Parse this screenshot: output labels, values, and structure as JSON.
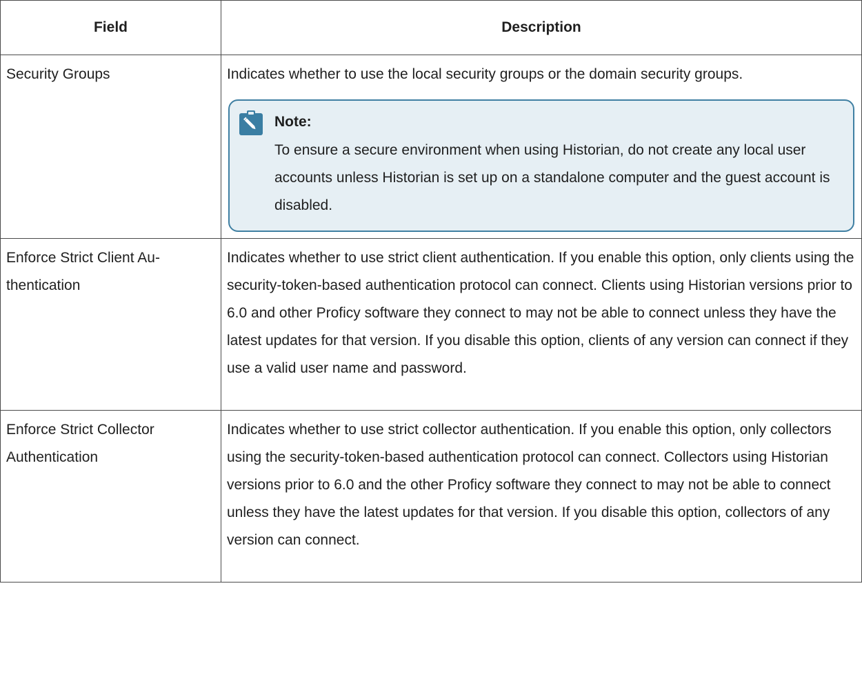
{
  "table": {
    "headers": {
      "field": "Field",
      "description": "Description"
    },
    "rows": [
      {
        "field": "Security Groups",
        "description": "Indicates whether to use the local security groups or the domain security groups.",
        "note": {
          "icon": "pencil-note-icon",
          "heading": "Note:",
          "body": "To ensure a secure environment when using Historian, do not create any local user accounts unless Historian is set up on a standalone computer and the guest account is disabled."
        }
      },
      {
        "field": "Enforce Strict Client Au­thentication",
        "description": "Indicates whether to use strict client authentication. If you enable this option, only clients using the security-token-based authentication protocol can con­nect. Clients using Historian versions prior to 6.0 and other Proficy software they connect to may not be able to connect unless they have the latest up­dates for that version. If you disable this option, clients of any version can connect if they use a valid user name and password."
      },
      {
        "field": "Enforce Strict Collector Authentication",
        "description": "Indicates whether to use strict collector authentication. If you enable this op­tion, only collectors using the security-token-based authentication protocol can connect. Collectors using Historian versions prior to 6.0 and the other Proficy software they connect to may not be able to connect unless they have the latest updates for that version. If you disable this option, collectors of any version can connect."
      }
    ]
  },
  "colors": {
    "border": "#4a4a4a",
    "note_border": "#3f7fa2",
    "note_background": "#e6eff4",
    "note_icon_background": "#3a7ea3"
  }
}
